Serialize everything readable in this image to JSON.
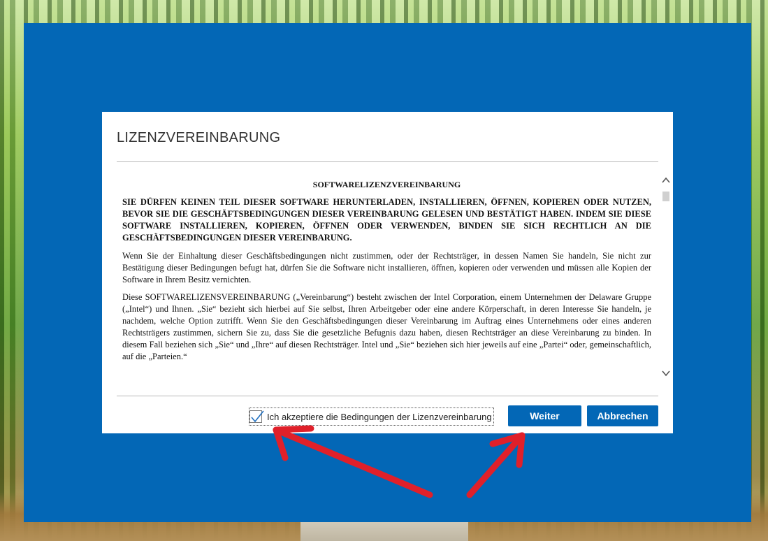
{
  "dialog": {
    "title": "LIZENZVEREINBARUNG",
    "license": {
      "heading": "SOFTWARELIZENZVEREINBARUNG",
      "warning": "SIE DÜRFEN KEINEN TEIL DIESER SOFTWARE HERUNTERLADEN, INSTALLIEREN, ÖFFNEN, KOPIEREN ODER NUTZEN, BEVOR SIE DIE GESCHÄFTSBEDINGUNGEN DIESER VEREINBARUNG GELESEN UND BESTÄTIGT HABEN. INDEM SIE DIESE SOFTWARE INSTALLIEREN, KOPIEREN, ÖFFNEN ODER VERWENDEN, BINDEN SIE SICH RECHTLICH AN DIE GESCHÄFTSBEDINGUNGEN DIESER VEREINBARUNG.",
      "paragraphs": [
        "Wenn Sie der Einhaltung dieser Geschäftsbedingungen nicht zustimmen, oder der Rechtsträger, in dessen Namen Sie handeln, Sie nicht zur Bestätigung dieser Bedingungen befugt hat, dürfen Sie die Software nicht installieren, öffnen, kopieren oder verwenden und müssen alle Kopien der Software in Ihrem Besitz vernichten.",
        "Diese SOFTWARELIZENSVEREINBARUNG („Vereinbarung“) besteht zwischen der Intel Corporation, einem Unternehmen der Delaware Gruppe („Intel“) und Ihnen. „Sie“ bezieht sich hierbei auf Sie selbst, Ihren Arbeitgeber oder eine andere Körperschaft, in deren Interesse Sie handeln, je nachdem, welche Option zutrifft. Wenn Sie den Geschäftsbedingungen dieser Vereinbarung im Auftrag eines Unternehmens oder eines anderen Rechtsträgers zustimmen, sichern Sie zu, dass Sie die gesetzliche Befugnis dazu haben, diesen Rechtsträger an diese Vereinbarung zu binden. In diesem Fall beziehen sich „Sie“ und „Ihre“ auf diesen Rechtsträger. Intel und „Sie“ beziehen sich hier jeweils auf eine „Partei“ oder, gemeinschaftlich, auf die „Parteien.“"
      ]
    },
    "accept_label": "Ich akzeptiere die Bedingungen der Lizenzvereinbarung",
    "accept_checked": true,
    "next_label": "Weiter",
    "cancel_label": "Abbrechen"
  },
  "colors": {
    "frame_blue": "#0367b6",
    "button_blue": "#0367b6",
    "annotation_red": "#e0202a"
  },
  "icons": {
    "checkmark": "checkmark-icon",
    "scroll_up": "chevron-up-icon",
    "scroll_down": "chevron-down-icon"
  }
}
